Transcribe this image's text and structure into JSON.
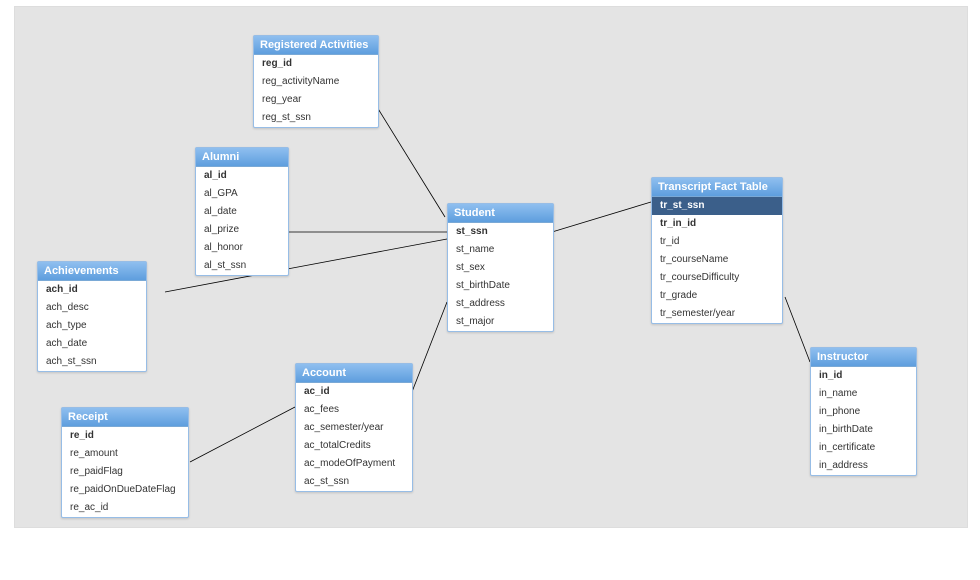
{
  "tables": {
    "registered_activities": {
      "title": "Registered Activities",
      "fields": [
        {
          "name": "reg_id",
          "pk": true
        },
        {
          "name": "reg_activityName"
        },
        {
          "name": "reg_year"
        },
        {
          "name": "reg_st_ssn"
        }
      ]
    },
    "alumni": {
      "title": "Alumni",
      "fields": [
        {
          "name": "al_id",
          "pk": true
        },
        {
          "name": "al_GPA"
        },
        {
          "name": "al_date"
        },
        {
          "name": "al_prize"
        },
        {
          "name": "al_honor"
        },
        {
          "name": "al_st_ssn"
        }
      ]
    },
    "achievements": {
      "title": "Achievements",
      "fields": [
        {
          "name": "ach_id",
          "pk": true
        },
        {
          "name": "ach_desc"
        },
        {
          "name": "ach_type"
        },
        {
          "name": "ach_date"
        },
        {
          "name": "ach_st_ssn"
        }
      ]
    },
    "receipt": {
      "title": "Receipt",
      "fields": [
        {
          "name": "re_id",
          "pk": true
        },
        {
          "name": "re_amount"
        },
        {
          "name": "re_paidFlag"
        },
        {
          "name": "re_paidOnDueDateFlag"
        },
        {
          "name": "re_ac_id"
        }
      ]
    },
    "account": {
      "title": "Account",
      "fields": [
        {
          "name": "ac_id",
          "pk": true
        },
        {
          "name": "ac_fees"
        },
        {
          "name": "ac_semester/year"
        },
        {
          "name": "ac_totalCredits"
        },
        {
          "name": "ac_modeOfPayment"
        },
        {
          "name": "ac_st_ssn"
        }
      ]
    },
    "student": {
      "title": "Student",
      "fields": [
        {
          "name": "st_ssn",
          "pk": true
        },
        {
          "name": "st_name"
        },
        {
          "name": "st_sex"
        },
        {
          "name": "st_birthDate"
        },
        {
          "name": "st_address"
        },
        {
          "name": "st_major"
        }
      ]
    },
    "transcript": {
      "title": "Transcript Fact Table",
      "fields": [
        {
          "name": "tr_st_ssn",
          "hl": true,
          "pk": true
        },
        {
          "name": "tr_in_id",
          "pk": true
        },
        {
          "name": "tr_id"
        },
        {
          "name": "tr_courseName"
        },
        {
          "name": "tr_courseDifficulty"
        },
        {
          "name": "tr_grade"
        },
        {
          "name": "tr_semester/year"
        }
      ]
    },
    "instructor": {
      "title": "Instructor",
      "fields": [
        {
          "name": "in_id",
          "pk": true
        },
        {
          "name": "in_name"
        },
        {
          "name": "in_phone"
        },
        {
          "name": "in_birthDate"
        },
        {
          "name": "in_certificate"
        },
        {
          "name": "in_address"
        }
      ]
    }
  }
}
